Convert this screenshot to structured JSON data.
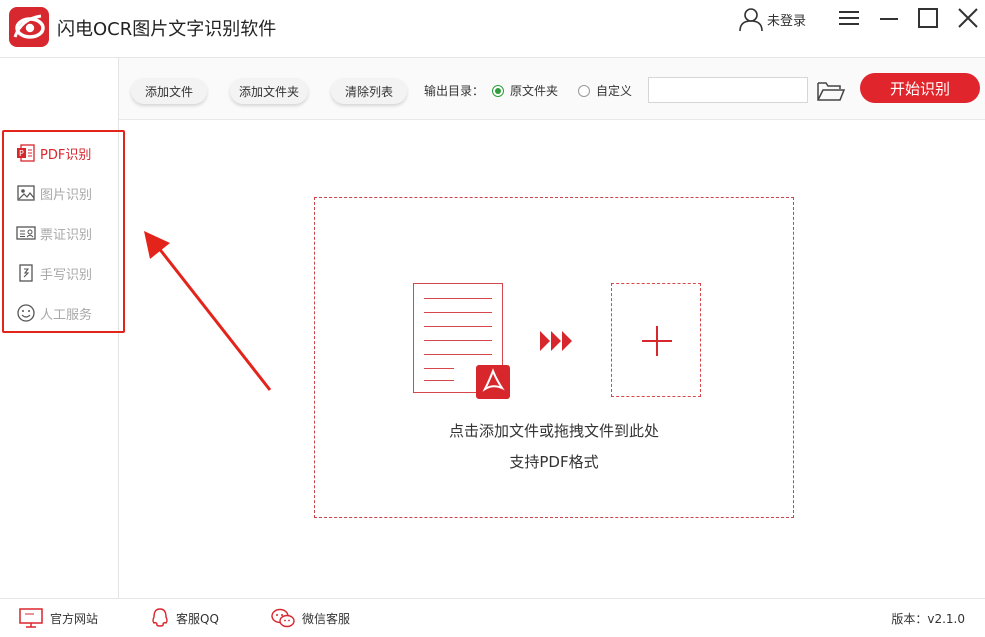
{
  "app": {
    "title": "闪电OCR图片文字识别软件"
  },
  "user": {
    "label": "未登录"
  },
  "sidebar": {
    "items": [
      {
        "label": "PDF识别",
        "icon": "pdf-icon",
        "active": true
      },
      {
        "label": "图片识别",
        "icon": "image-icon",
        "active": false
      },
      {
        "label": "票证识别",
        "icon": "id-card-icon",
        "active": false
      },
      {
        "label": "手写识别",
        "icon": "handwriting-icon",
        "active": false
      },
      {
        "label": "人工服务",
        "icon": "smile-icon",
        "active": false
      }
    ]
  },
  "toolbar": {
    "add_file": "添加文件",
    "add_folder": "添加文件夹",
    "clear_list": "清除列表",
    "output_label": "输出目录：",
    "radio_original": "原文件夹",
    "radio_custom": "自定义",
    "output_path": "",
    "start": "开始识别"
  },
  "dropzone": {
    "hint_line1": "点击添加文件或拖拽文件到此处",
    "hint_line2": "支持PDF格式"
  },
  "footer": {
    "website": "官方网站",
    "qq": "客服QQ",
    "wechat": "微信客服",
    "version": "版本：v2.1.0"
  },
  "colors": {
    "accent": "#d8262d",
    "radio_on": "#2d9d3a",
    "muted": "#a8a8a8"
  }
}
